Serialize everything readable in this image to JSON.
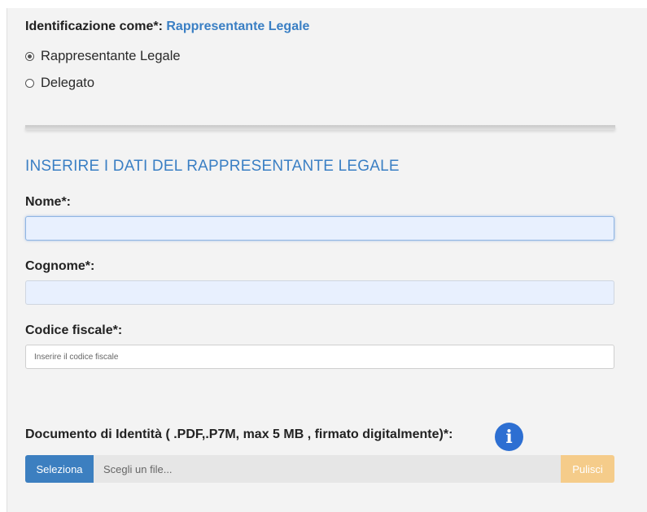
{
  "identification": {
    "label": "Identificazione come*:",
    "value": "Rappresentante Legale",
    "options": [
      {
        "label": "Rappresentante Legale",
        "checked": true
      },
      {
        "label": "Delegato",
        "checked": false
      }
    ]
  },
  "section_title": "INSERIRE I DATI DEL RAPPRESENTANTE LEGALE",
  "fields": {
    "nome": {
      "label": "Nome*:",
      "value": ""
    },
    "cognome": {
      "label": "Cognome*:",
      "value": ""
    },
    "codice_fiscale": {
      "label": "Codice fiscale*:",
      "value": "",
      "placeholder": "Inserire il codice fiscale"
    }
  },
  "document": {
    "label": "Documento di Identità ( .PDF,.P7M, max 5 MB , firmato digitalmente)*:",
    "info_icon": "info-icon",
    "select_label": "Seleziona",
    "file_placeholder": "Scegli un file...",
    "clear_label": "Pulisci"
  },
  "colors": {
    "accent": "#3a7fc4",
    "select_button": "#3c7fc0",
    "clear_button": "#f5cc8a",
    "info_icon": "#2d6fd2"
  }
}
